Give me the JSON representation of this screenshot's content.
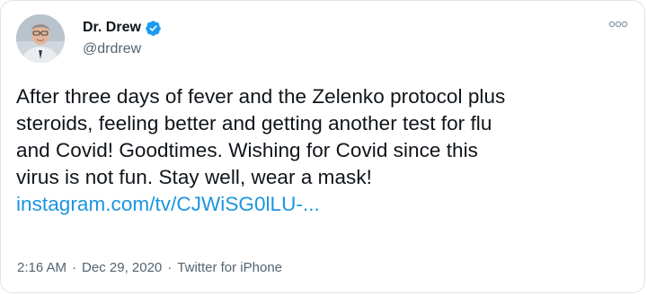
{
  "author": {
    "display_name": "Dr. Drew",
    "handle": "@drdrew",
    "verified": true
  },
  "tweet": {
    "lines": [
      "After three days of fever and the Zelenko protocol plus",
      "steroids, feeling better and getting another test for flu",
      "and Covid! Goodtimes. Wishing for Covid since this",
      "virus is not fun. Stay well, wear a mask!"
    ],
    "link": "instagram.com/tv/CJWiSG0lLU-..."
  },
  "meta": {
    "time": "2:16 AM",
    "separator": "·",
    "date": "Dec 29, 2020",
    "source": "Twitter for iPhone"
  },
  "colors": {
    "text": "#0f1419",
    "secondary": "#536471",
    "link": "#1b95e0",
    "verified": "#1d9bf0"
  },
  "icons": {
    "verified": "verified-badge-icon",
    "more": "more-options-icon"
  }
}
